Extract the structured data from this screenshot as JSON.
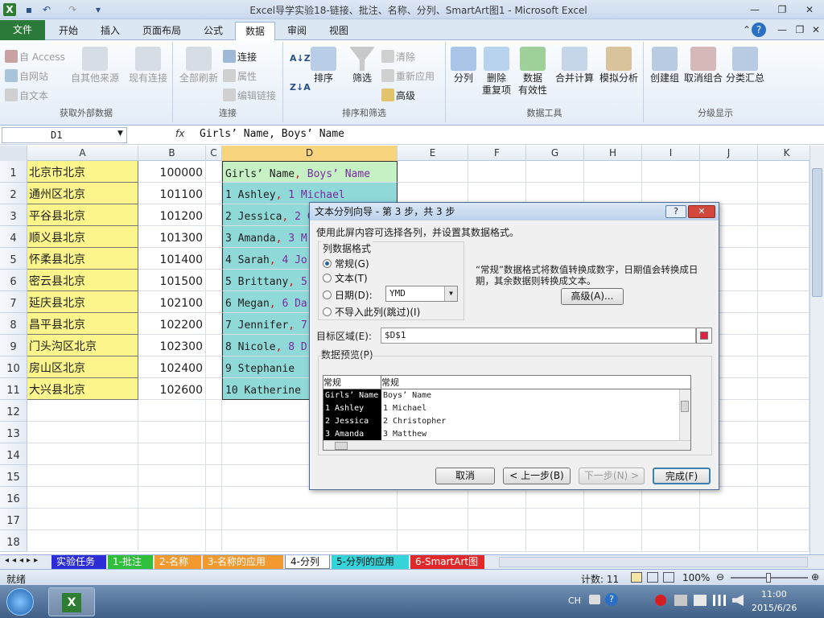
{
  "window": {
    "title": "Excel导学实验18-链接、批注、名称、分列、SmartArt图1 - Microsoft Excel"
  },
  "tabs": [
    "文件",
    "开始",
    "插入",
    "页面布局",
    "公式",
    "数据",
    "审阅",
    "视图"
  ],
  "ribbon": {
    "external_data": {
      "access": "自 Access",
      "web": "自网站",
      "text": "自文本",
      "other": "自其他来源",
      "existing": "现有连接",
      "label": "获取外部数据"
    },
    "connections": {
      "refresh": "全部刷新",
      "conn": "连接",
      "props": "属性",
      "edit_links": "编辑链接",
      "label": "连接"
    },
    "sort_filter": {
      "sort": "排序",
      "filter": "筛选",
      "clear": "清除",
      "reapply": "重新应用",
      "advanced": "高级",
      "label": "排序和筛选"
    },
    "tools": {
      "split": "分列",
      "remove_dup_1": "删除",
      "remove_dup_2": "重复项",
      "validation_1": "数据",
      "validation_2": "有效性",
      "consolidate": "合并计算",
      "whatif": "模拟分析",
      "label": "数据工具"
    },
    "outline": {
      "group": "创建组",
      "ungroup": "取消组合",
      "subtotal": "分类汇总",
      "label": "分级显示"
    }
  },
  "formula_bar": {
    "name_box": "D1",
    "fx": "fx",
    "formula": "Girls’ Name, Boys’ Name"
  },
  "columns": [
    "A",
    "B",
    "C",
    "D",
    "E",
    "F",
    "G",
    "H",
    "I",
    "J",
    "K"
  ],
  "rows": [
    "1",
    "2",
    "3",
    "4",
    "5",
    "6",
    "7",
    "8",
    "9",
    "10",
    "11",
    "12",
    "13",
    "14",
    "15",
    "16",
    "17",
    "18"
  ],
  "cells": {
    "A": [
      "北京市北京",
      "通州区北京",
      "平谷县北京",
      "顺义县北京",
      "怀柔县北京",
      "密云县北京",
      "延庆县北京",
      "昌平县北京",
      "门头沟区北京",
      "房山区北京",
      "大兴县北京"
    ],
    "B": [
      "100000",
      "101100",
      "101200",
      "101300",
      "101400",
      "101500",
      "102100",
      "102200",
      "102300",
      "102400",
      "102600"
    ],
    "D_left": [
      "Girls’ Name",
      "1 Ashley",
      "2 Jessica",
      "3 Amanda",
      "4 Sarah",
      "5 Brittany",
      "6 Megan",
      "7 Jennifer",
      "8 Nicole",
      "9 Stephanie",
      "10 Katherine"
    ],
    "D_right": [
      "Boys’ Name",
      "1 Michael",
      "2 C",
      "3 M",
      "4 Jo",
      "5",
      "6 Da",
      "7",
      "8 D",
      "",
      ""
    ]
  },
  "sheet_tabs": [
    "实验任务",
    "1-批注",
    "2-名称",
    "3-名称的应用",
    "4-分列",
    "5-分列的应用",
    "6-SmartArt图"
  ],
  "status": {
    "ready": "就绪",
    "count": "计数: 11",
    "zoom": "100%"
  },
  "taskbar": {
    "lang": "CH",
    "time": "11:00",
    "date": "2015/6/26"
  },
  "dialog": {
    "title": "文本分列向导 - 第 3 步，共 3 步",
    "help": "?",
    "close": "✕",
    "instruction": "使用此屏内容可选择各列，并设置其数据格式。",
    "format_group": "列数据格式",
    "opt_general": "常规(G)",
    "opt_text": "文本(T)",
    "opt_date": "日期(D):",
    "date_value": "YMD",
    "opt_skip": "不导入此列(跳过)(I)",
    "desc": "“常规”数据格式将数值转换成数字，日期值会转换成日期，其余数据则转换成文本。",
    "advanced": "高级(A)...",
    "dest_label": "目标区域(E):",
    "dest_value": "$D$1",
    "preview_label": "数据预览(P)",
    "preview_headers": [
      "常规",
      "常规"
    ],
    "preview_rows": [
      [
        "Girls’ Name",
        "Boys’ Name"
      ],
      [
        "1 Ashley",
        "1 Michael"
      ],
      [
        "2 Jessica",
        "2 Christopher"
      ],
      [
        "3 Amanda",
        "3 Matthew"
      ]
    ],
    "btn_cancel": "取消",
    "btn_back": "< 上一步(B)",
    "btn_next": "下一步(N) >",
    "btn_finish": "完成(F)"
  }
}
